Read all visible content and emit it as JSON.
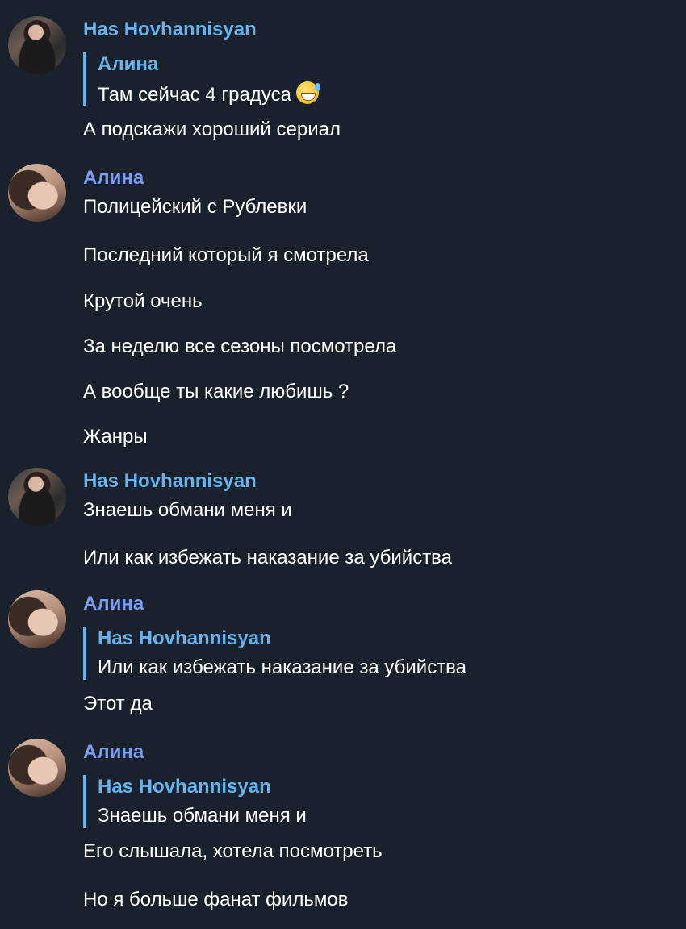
{
  "messages": [
    {
      "sender": "Has Hovhannisyan",
      "reply": {
        "author": "Алина",
        "text": "Там сейчас 4 градуса",
        "emoji": "sweat-smile-emoji"
      },
      "lines": [
        "А подскажи хороший сериал"
      ]
    },
    {
      "sender": "Алина",
      "lines": [
        "Полицейский с Рублевки",
        "Последний который я смотрела",
        "Крутой очень",
        "За неделю все сезоны посмотрела",
        "А вообще ты какие любишь ?",
        "Жанры"
      ]
    },
    {
      "sender": "Has Hovhannisyan",
      "lines": [
        "Знаешь обмани меня и",
        "Или как избежать наказание за убийства"
      ]
    },
    {
      "sender": "Алина",
      "reply": {
        "author": "Has Hovhannisyan",
        "text": "Или как избежать наказание за убийства"
      },
      "lines": [
        "Этот да"
      ]
    },
    {
      "sender": "Алина",
      "reply": {
        "author": "Has Hovhannisyan",
        "text": "Знаешь обмани меня и"
      },
      "lines": [
        "Его слышала, хотела посмотреть",
        "Но я больше фанат фильмов"
      ]
    }
  ],
  "colors": {
    "background": "#19212c",
    "has_name": "#64b5ef",
    "alina_name": "#7c9cf0",
    "reply_bar": "#64b5ef"
  }
}
